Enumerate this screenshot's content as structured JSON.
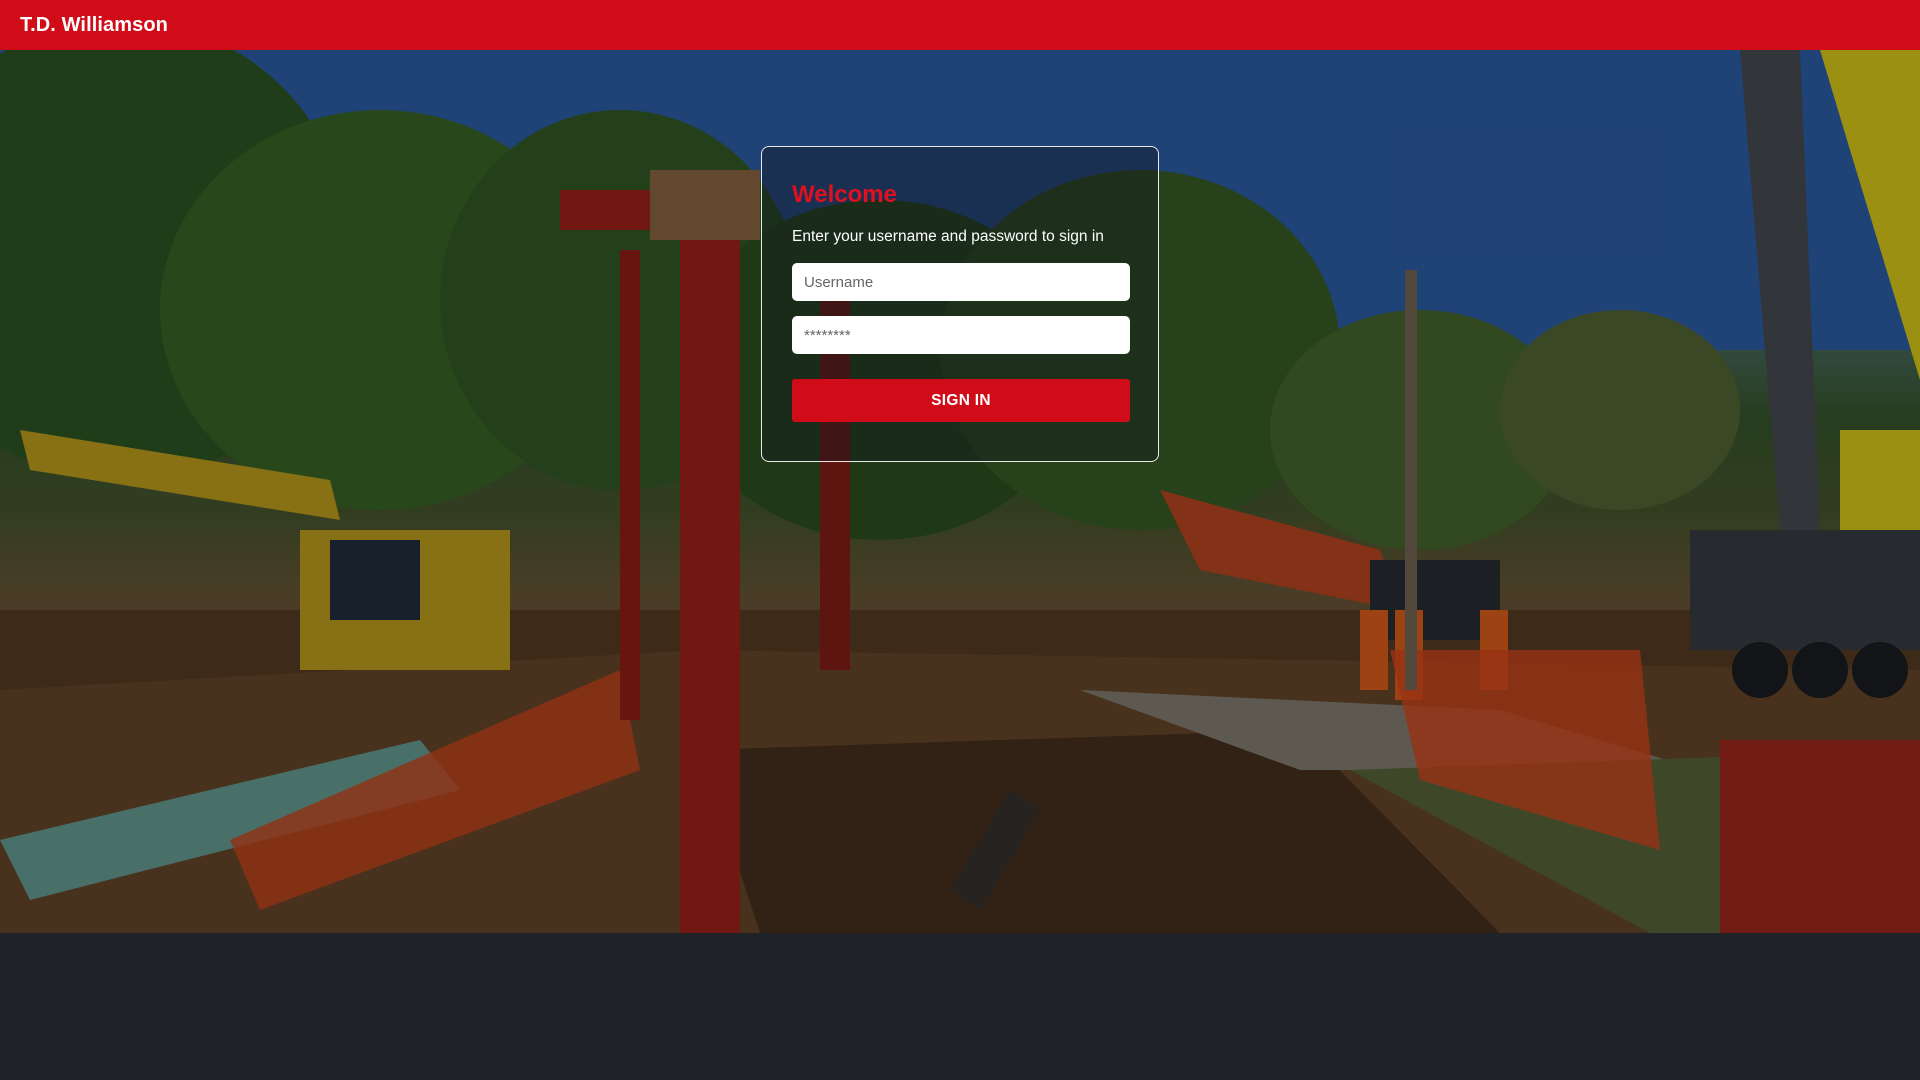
{
  "header": {
    "brand": "T.D. Williamson"
  },
  "login": {
    "title": "Welcome",
    "subtitle": "Enter your username and password to sign in",
    "username_placeholder": "Username",
    "password_placeholder": "********",
    "submit_label": "SIGN IN"
  },
  "colors": {
    "brand_red": "#d00c18",
    "title_red": "#e0101e",
    "page_background": "#1f2226"
  },
  "background": {
    "description_icon": "construction-site-photo"
  }
}
